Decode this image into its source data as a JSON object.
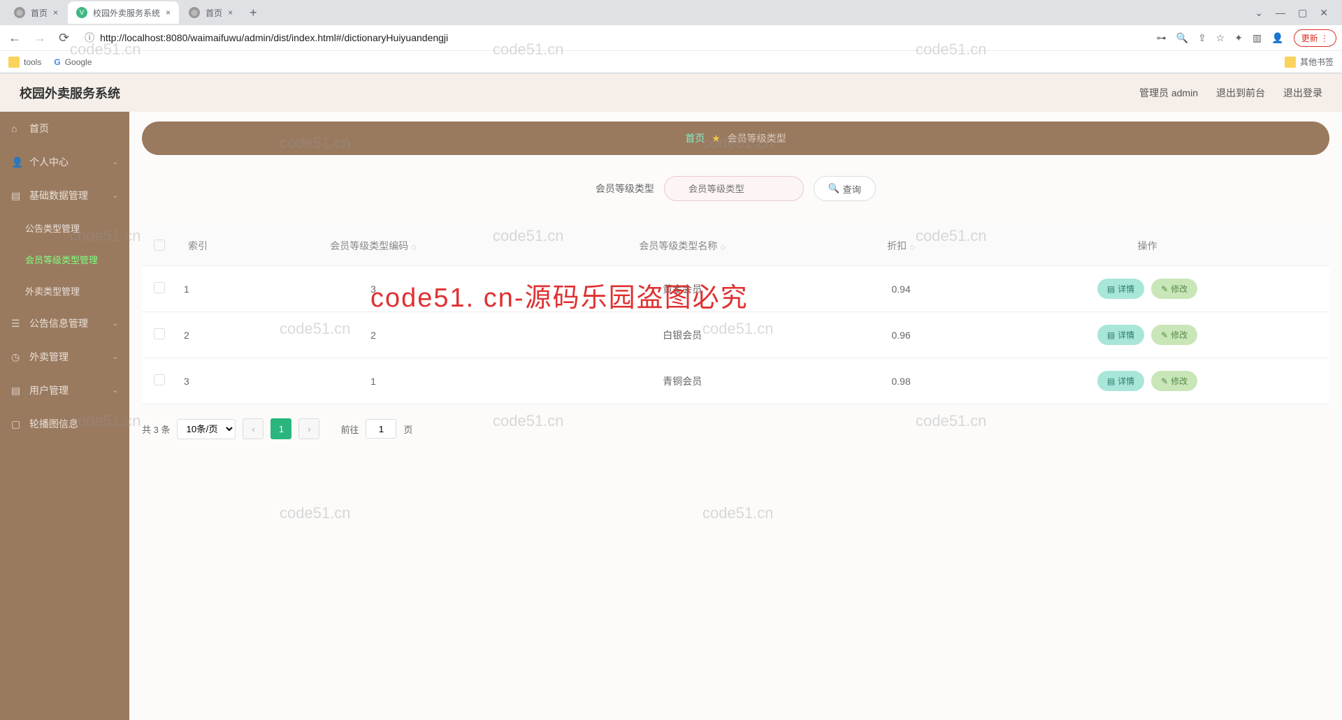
{
  "browser": {
    "tabs": [
      {
        "title": "首页",
        "active": false
      },
      {
        "title": "校园外卖服务系统",
        "active": true
      },
      {
        "title": "首页",
        "active": false
      }
    ],
    "url": "http://localhost:8080/waimaifuwu/admin/dist/index.html#/dictionaryHuiyuandengji",
    "update_label": "更新",
    "bookmarks": {
      "tools": "tools",
      "google": "Google",
      "other": "其他书签"
    }
  },
  "app": {
    "title": "校园外卖服务系统",
    "header": {
      "user": "管理员 admin",
      "logout_front": "退出到前台",
      "logout": "退出登录"
    }
  },
  "sidebar": {
    "home": "首页",
    "personal": "个人中心",
    "basic_data": "基础数据管理",
    "subs": {
      "announce_type": "公告类型管理",
      "member_level": "会员等级类型管理",
      "delivery_type": "外卖类型管理"
    },
    "announcement": "公告信息管理",
    "delivery": "外卖管理",
    "user": "用户管理",
    "carousel": "轮播图信息"
  },
  "breadcrumb": {
    "home": "首页",
    "current": "会员等级类型"
  },
  "search": {
    "label": "会员等级类型",
    "placeholder": "会员等级类型",
    "btn": "查询"
  },
  "table": {
    "cols": {
      "index": "索引",
      "code": "会员等级类型编码",
      "name": "会员等级类型名称",
      "discount": "折扣",
      "action": "操作"
    },
    "rows": [
      {
        "idx": "1",
        "code": "3",
        "name": "黄金会员",
        "discount": "0.94"
      },
      {
        "idx": "2",
        "code": "2",
        "name": "白银会员",
        "discount": "0.96"
      },
      {
        "idx": "3",
        "code": "1",
        "name": "青铜会员",
        "discount": "0.98"
      }
    ],
    "actions": {
      "detail": "详情",
      "edit": "修改"
    }
  },
  "pagination": {
    "total": "共 3 条",
    "per_page": "10条/页",
    "current": "1",
    "goto_prefix": "前往",
    "goto_value": "1",
    "goto_suffix": "页"
  },
  "watermark": "code51.cn",
  "big_watermark": "code51. cn-源码乐园盗图必究"
}
